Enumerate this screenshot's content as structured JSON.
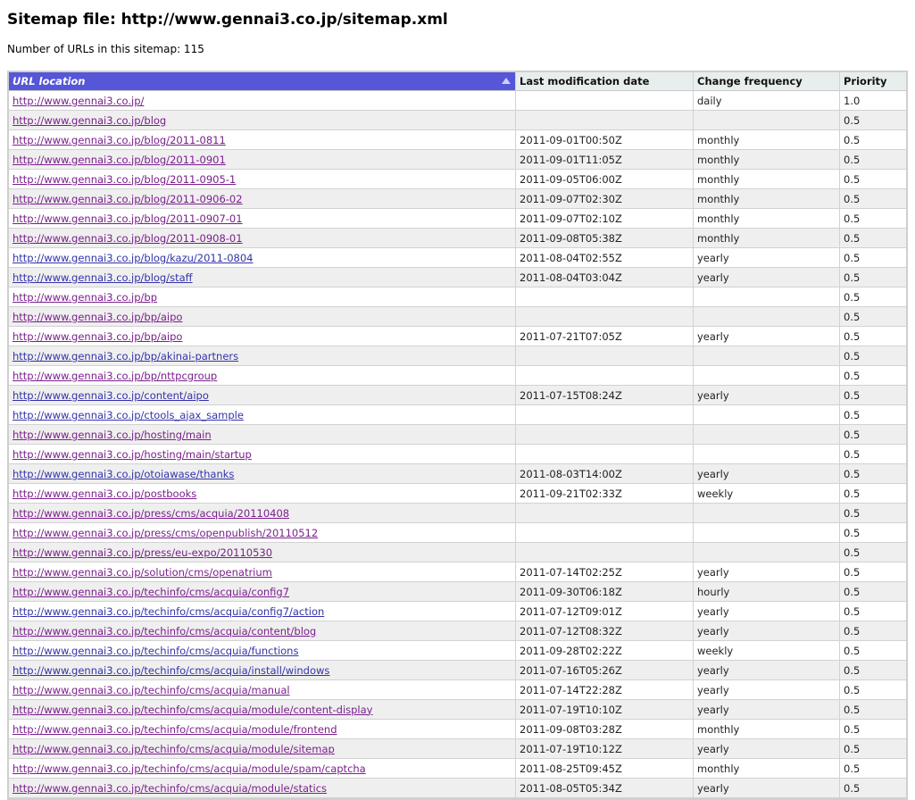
{
  "page": {
    "title": "Sitemap file: http://www.gennai3.co.jp/sitemap.xml",
    "count_text": "Number of URLs in this sitemap: 115"
  },
  "table": {
    "headers": [
      "URL location",
      "Last modification date",
      "Change frequency",
      "Priority"
    ],
    "rows": [
      {
        "url": "http://www.gennai3.co.jp/",
        "lastmod": "",
        "freq": "daily",
        "priority": "1.0",
        "visited": true
      },
      {
        "url": "http://www.gennai3.co.jp/blog",
        "lastmod": "",
        "freq": "",
        "priority": "0.5",
        "visited": true
      },
      {
        "url": "http://www.gennai3.co.jp/blog/2011-0811",
        "lastmod": "2011-09-01T00:50Z",
        "freq": "monthly",
        "priority": "0.5",
        "visited": true
      },
      {
        "url": "http://www.gennai3.co.jp/blog/2011-0901",
        "lastmod": "2011-09-01T11:05Z",
        "freq": "monthly",
        "priority": "0.5",
        "visited": true
      },
      {
        "url": "http://www.gennai3.co.jp/blog/2011-0905-1",
        "lastmod": "2011-09-05T06:00Z",
        "freq": "monthly",
        "priority": "0.5",
        "visited": true
      },
      {
        "url": "http://www.gennai3.co.jp/blog/2011-0906-02",
        "lastmod": "2011-09-07T02:30Z",
        "freq": "monthly",
        "priority": "0.5",
        "visited": true
      },
      {
        "url": "http://www.gennai3.co.jp/blog/2011-0907-01",
        "lastmod": "2011-09-07T02:10Z",
        "freq": "monthly",
        "priority": "0.5",
        "visited": true
      },
      {
        "url": "http://www.gennai3.co.jp/blog/2011-0908-01",
        "lastmod": "2011-09-08T05:38Z",
        "freq": "monthly",
        "priority": "0.5",
        "visited": true
      },
      {
        "url": "http://www.gennai3.co.jp/blog/kazu/2011-0804",
        "lastmod": "2011-08-04T02:55Z",
        "freq": "yearly",
        "priority": "0.5",
        "visited": false
      },
      {
        "url": "http://www.gennai3.co.jp/blog/staff",
        "lastmod": "2011-08-04T03:04Z",
        "freq": "yearly",
        "priority": "0.5",
        "visited": false
      },
      {
        "url": "http://www.gennai3.co.jp/bp",
        "lastmod": "",
        "freq": "",
        "priority": "0.5",
        "visited": true
      },
      {
        "url": "http://www.gennai3.co.jp/bp/aipo",
        "lastmod": "",
        "freq": "",
        "priority": "0.5",
        "visited": true
      },
      {
        "url": "http://www.gennai3.co.jp/bp/aipo",
        "lastmod": "2011-07-21T07:05Z",
        "freq": "yearly",
        "priority": "0.5",
        "visited": true
      },
      {
        "url": "http://www.gennai3.co.jp/bp/akinai-partners",
        "lastmod": "",
        "freq": "",
        "priority": "0.5",
        "visited": false
      },
      {
        "url": "http://www.gennai3.co.jp/bp/nttpcgroup",
        "lastmod": "",
        "freq": "",
        "priority": "0.5",
        "visited": true
      },
      {
        "url": "http://www.gennai3.co.jp/content/aipo",
        "lastmod": "2011-07-15T08:24Z",
        "freq": "yearly",
        "priority": "0.5",
        "visited": false
      },
      {
        "url": "http://www.gennai3.co.jp/ctools_ajax_sample",
        "lastmod": "",
        "freq": "",
        "priority": "0.5",
        "visited": false
      },
      {
        "url": "http://www.gennai3.co.jp/hosting/main",
        "lastmod": "",
        "freq": "",
        "priority": "0.5",
        "visited": true
      },
      {
        "url": "http://www.gennai3.co.jp/hosting/main/startup",
        "lastmod": "",
        "freq": "",
        "priority": "0.5",
        "visited": true
      },
      {
        "url": "http://www.gennai3.co.jp/otoiawase/thanks",
        "lastmod": "2011-08-03T14:00Z",
        "freq": "yearly",
        "priority": "0.5",
        "visited": false
      },
      {
        "url": "http://www.gennai3.co.jp/postbooks",
        "lastmod": "2011-09-21T02:33Z",
        "freq": "weekly",
        "priority": "0.5",
        "visited": true
      },
      {
        "url": "http://www.gennai3.co.jp/press/cms/acquia/20110408",
        "lastmod": "",
        "freq": "",
        "priority": "0.5",
        "visited": true
      },
      {
        "url": "http://www.gennai3.co.jp/press/cms/openpublish/20110512",
        "lastmod": "",
        "freq": "",
        "priority": "0.5",
        "visited": true
      },
      {
        "url": "http://www.gennai3.co.jp/press/eu-expo/20110530",
        "lastmod": "",
        "freq": "",
        "priority": "0.5",
        "visited": true
      },
      {
        "url": "http://www.gennai3.co.jp/solution/cms/openatrium",
        "lastmod": "2011-07-14T02:25Z",
        "freq": "yearly",
        "priority": "0.5",
        "visited": true
      },
      {
        "url": "http://www.gennai3.co.jp/techinfo/cms/acquia/config7",
        "lastmod": "2011-09-30T06:18Z",
        "freq": "hourly",
        "priority": "0.5",
        "visited": true
      },
      {
        "url": "http://www.gennai3.co.jp/techinfo/cms/acquia/config7/action",
        "lastmod": "2011-07-12T09:01Z",
        "freq": "yearly",
        "priority": "0.5",
        "visited": false
      },
      {
        "url": "http://www.gennai3.co.jp/techinfo/cms/acquia/content/blog",
        "lastmod": "2011-07-12T08:32Z",
        "freq": "yearly",
        "priority": "0.5",
        "visited": true
      },
      {
        "url": "http://www.gennai3.co.jp/techinfo/cms/acquia/functions",
        "lastmod": "2011-09-28T02:22Z",
        "freq": "weekly",
        "priority": "0.5",
        "visited": false
      },
      {
        "url": "http://www.gennai3.co.jp/techinfo/cms/acquia/install/windows",
        "lastmod": "2011-07-16T05:26Z",
        "freq": "yearly",
        "priority": "0.5",
        "visited": false
      },
      {
        "url": "http://www.gennai3.co.jp/techinfo/cms/acquia/manual",
        "lastmod": "2011-07-14T22:28Z",
        "freq": "yearly",
        "priority": "0.5",
        "visited": true
      },
      {
        "url": "http://www.gennai3.co.jp/techinfo/cms/acquia/module/content-display",
        "lastmod": "2011-07-19T10:10Z",
        "freq": "yearly",
        "priority": "0.5",
        "visited": true
      },
      {
        "url": "http://www.gennai3.co.jp/techinfo/cms/acquia/module/frontend",
        "lastmod": "2011-09-08T03:28Z",
        "freq": "monthly",
        "priority": "0.5",
        "visited": true
      },
      {
        "url": "http://www.gennai3.co.jp/techinfo/cms/acquia/module/sitemap",
        "lastmod": "2011-07-19T10:12Z",
        "freq": "yearly",
        "priority": "0.5",
        "visited": true
      },
      {
        "url": "http://www.gennai3.co.jp/techinfo/cms/acquia/module/spam/captcha",
        "lastmod": "2011-08-25T09:45Z",
        "freq": "monthly",
        "priority": "0.5",
        "visited": true
      },
      {
        "url": "http://www.gennai3.co.jp/techinfo/cms/acquia/module/statics",
        "lastmod": "2011-08-05T05:34Z",
        "freq": "yearly",
        "priority": "0.5",
        "visited": true
      }
    ]
  },
  "colors": {
    "sorted_header_bg": "#5656d8",
    "link": "#3333aa",
    "link_visited": "#7a1f8c"
  }
}
